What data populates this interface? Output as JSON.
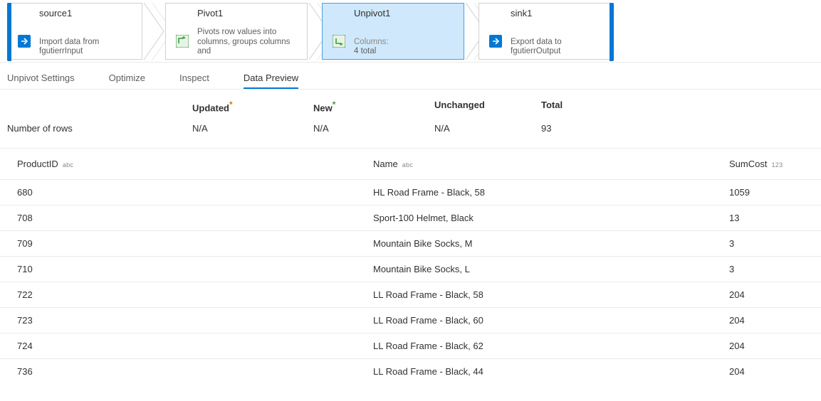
{
  "pipeline": {
    "nodes": [
      {
        "title": "source1",
        "subtitle": "Import data from fgutierrInput",
        "sublabel": "",
        "selected": false,
        "icon": "source"
      },
      {
        "title": "Pivot1",
        "subtitle": "Pivots row values into columns, groups columns and",
        "sublabel": "",
        "selected": false,
        "icon": "pivot"
      },
      {
        "title": "Unpivot1",
        "subtitle": "4 total",
        "sublabel": "Columns:",
        "selected": true,
        "icon": "unpivot"
      },
      {
        "title": "sink1",
        "subtitle": "Export data to fgutierrOutput",
        "sublabel": "",
        "selected": false,
        "icon": "sink"
      }
    ]
  },
  "tabs": [
    {
      "label": "Unpivot Settings",
      "active": false
    },
    {
      "label": "Optimize",
      "active": false
    },
    {
      "label": "Inspect",
      "active": false
    },
    {
      "label": "Data Preview",
      "active": true
    }
  ],
  "stats": {
    "rowLabel": "Number of rows",
    "columns": [
      {
        "header": "Updated",
        "marker": "orange",
        "value": "N/A"
      },
      {
        "header": "New",
        "marker": "green",
        "value": "N/A"
      },
      {
        "header": "Unchanged",
        "marker": "",
        "value": "N/A"
      },
      {
        "header": "Total",
        "marker": "",
        "value": "93"
      }
    ]
  },
  "grid": {
    "columns": [
      {
        "name": "ProductID",
        "type": "abc"
      },
      {
        "name": "Name",
        "type": "abc"
      },
      {
        "name": "SumCost",
        "type": "123"
      }
    ],
    "rows": [
      {
        "ProductID": "680",
        "Name": "HL Road Frame - Black, 58",
        "SumCost": "1059"
      },
      {
        "ProductID": "708",
        "Name": "Sport-100 Helmet, Black",
        "SumCost": "13"
      },
      {
        "ProductID": "709",
        "Name": "Mountain Bike Socks, M",
        "SumCost": "3"
      },
      {
        "ProductID": "710",
        "Name": "Mountain Bike Socks, L",
        "SumCost": "3"
      },
      {
        "ProductID": "722",
        "Name": "LL Road Frame - Black, 58",
        "SumCost": "204"
      },
      {
        "ProductID": "723",
        "Name": "LL Road Frame - Black, 60",
        "SumCost": "204"
      },
      {
        "ProductID": "724",
        "Name": "LL Road Frame - Black, 62",
        "SumCost": "204"
      },
      {
        "ProductID": "736",
        "Name": "LL Road Frame - Black, 44",
        "SumCost": "204"
      }
    ]
  }
}
